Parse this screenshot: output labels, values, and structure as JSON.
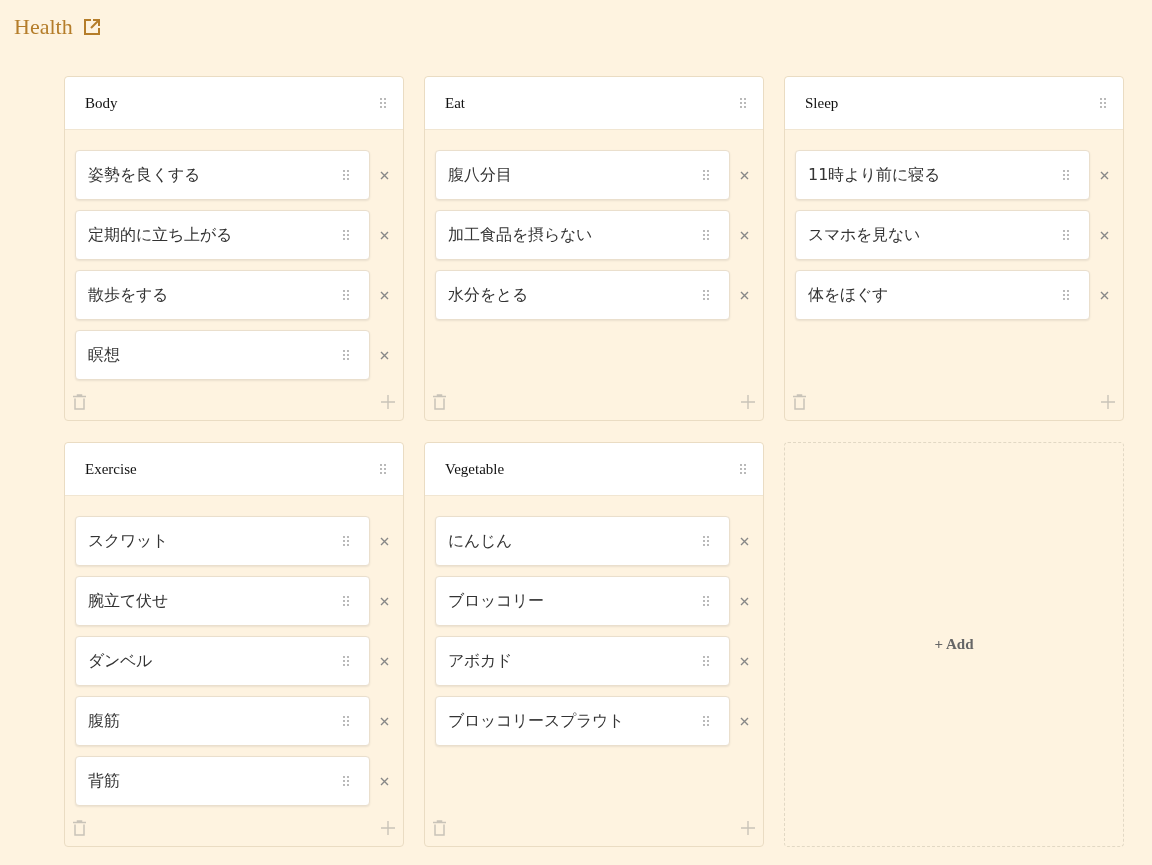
{
  "title": "Health",
  "boards": [
    {
      "name": "Body",
      "items": [
        "姿勢を良くする",
        "定期的に立ち上がる",
        "散歩をする",
        "瞑想"
      ]
    },
    {
      "name": "Eat",
      "items": [
        "腹八分目",
        "加工食品を摂らない",
        "水分をとる"
      ]
    },
    {
      "name": "Sleep",
      "items": [
        "11時より前に寝る",
        "スマホを見ない",
        "体をほぐす"
      ]
    },
    {
      "name": "Exercise",
      "items": [
        "スクワット",
        "腕立て伏せ",
        "ダンベル",
        "腹筋",
        "背筋"
      ]
    },
    {
      "name": "Vegetable",
      "items": [
        "にんじん",
        "ブロッコリー",
        "アボカド",
        "ブロッコリースプラウト"
      ]
    }
  ],
  "add_label": "+ Add"
}
